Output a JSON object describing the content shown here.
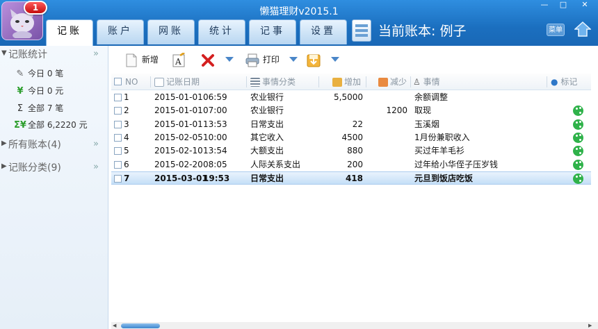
{
  "app": {
    "title": "懒猫理财v2015.1",
    "badge": "1",
    "current_book_label": "当前账本: 例子",
    "menu_label": "菜单"
  },
  "window_buttons": {
    "min": "—",
    "max": "□",
    "close": "✕"
  },
  "tabs": [
    {
      "label": "记账",
      "active": true
    },
    {
      "label": "账户"
    },
    {
      "label": "网账"
    },
    {
      "label": "统计"
    },
    {
      "label": "记事"
    },
    {
      "label": "设置"
    }
  ],
  "sidebar": {
    "sections": [
      {
        "label": "记账统计",
        "expanded": true
      },
      {
        "label": "所有账本(4)"
      },
      {
        "label": "记账分类(9)"
      }
    ],
    "items": [
      {
        "icon": "pen-icon",
        "label": "今日 0 笔"
      },
      {
        "icon": "yen-icon",
        "label": "今日 0 元"
      },
      {
        "icon": "sigma-pen-icon",
        "label": "全部 7 笔"
      },
      {
        "icon": "sigma-yen-icon",
        "label": "全部 6,2220 元"
      }
    ]
  },
  "toolbar": {
    "new_label": "新增",
    "print_label": "打印"
  },
  "table": {
    "columns": [
      "NO",
      "记账日期",
      "事情分类",
      "增加",
      "减少",
      "事情",
      "标记"
    ],
    "rows": [
      {
        "no": "1",
        "date": "2015-01-01",
        "time": "06:59",
        "category": "农业银行",
        "increase": "5,5000",
        "decrease": "",
        "note": "余额调整",
        "mark": false
      },
      {
        "no": "2",
        "date": "2015-01-01",
        "time": "07:00",
        "category": "农业银行",
        "increase": "",
        "decrease": "1200",
        "note": "取现",
        "mark": true
      },
      {
        "no": "3",
        "date": "2015-01-01",
        "time": "13:53",
        "category": "日常支出",
        "increase": "22",
        "decrease": "",
        "note": "玉溪烟",
        "mark": true
      },
      {
        "no": "4",
        "date": "2015-02-05",
        "time": "10:00",
        "category": "其它收入",
        "increase": "4500",
        "decrease": "",
        "note": "1月份兼职收入",
        "mark": true
      },
      {
        "no": "5",
        "date": "2015-02-10",
        "time": "13:54",
        "category": "大额支出",
        "increase": "880",
        "decrease": "",
        "note": "买过年羊毛衫",
        "mark": true
      },
      {
        "no": "6",
        "date": "2015-02-20",
        "time": "08:05",
        "category": "人际关系支出",
        "increase": "200",
        "decrease": "",
        "note": "过年给小华侄子压岁钱",
        "mark": true
      },
      {
        "no": "7",
        "date": "2015-03-01",
        "time": "19:53",
        "category": "日常支出",
        "increase": "418",
        "decrease": "",
        "note": "元旦到饭店吃饭",
        "mark": true,
        "selected": true
      }
    ]
  },
  "colors": {
    "titlebar": "#1f7fd0",
    "accent": "#3d86cf",
    "mark_green": "#2fb24a",
    "selected_row": "#c5dff7"
  }
}
